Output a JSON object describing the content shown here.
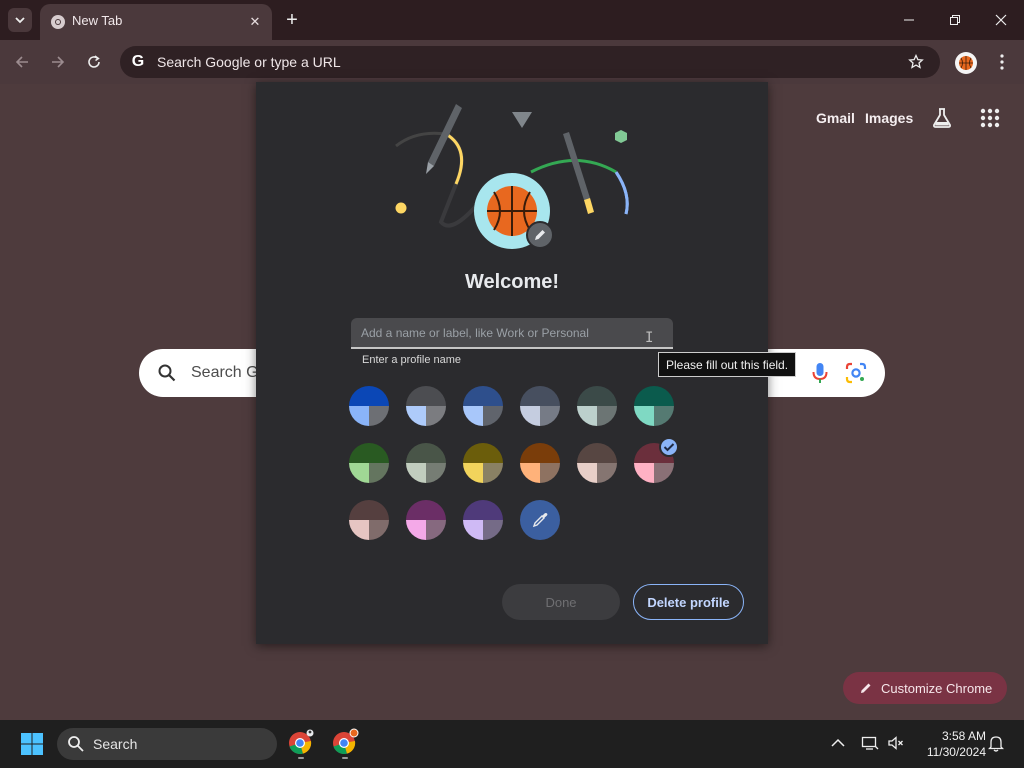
{
  "browser": {
    "tab_title": "New Tab",
    "omnibox_placeholder": "Search Google or type a URL"
  },
  "ntp": {
    "gmail_link": "Gmail",
    "images_link": "Images",
    "search_placeholder": "Search Go",
    "customize_label": "Customize Chrome"
  },
  "dialog": {
    "title": "Welcome!",
    "name_placeholder": "Add a name or label, like Work or Personal",
    "helper_text": "Enter a profile name",
    "done_label": "Done",
    "delete_label": "Delete profile",
    "tooltip": "Please fill out this field.",
    "color_swatches": [
      {
        "top": "#0b47b6",
        "left": "#8ab4f8",
        "right": "#6d6f74"
      },
      {
        "top": "#4c4d51",
        "left": "#aecbfa",
        "right": "#7b7c80"
      },
      {
        "top": "#2e4f8c",
        "left": "#a8c7fa",
        "right": "#60646c"
      },
      {
        "top": "#474f5f",
        "left": "#c5cde0",
        "right": "#767b86"
      },
      {
        "top": "#3b4a48",
        "left": "#bcd0cc",
        "right": "#6c7574"
      },
      {
        "top": "#0b5b4d",
        "left": "#7fd9c3",
        "right": "#557a72"
      },
      {
        "top": "#295a22",
        "left": "#a0d895",
        "right": "#64755f"
      },
      {
        "top": "#495548",
        "left": "#c1cdbe",
        "right": "#767d74"
      },
      {
        "top": "#6b5d0b",
        "left": "#f2d45c",
        "right": "#8a8164"
      },
      {
        "top": "#7a3d0a",
        "left": "#ffb27a",
        "right": "#8e7261"
      },
      {
        "top": "#574642",
        "left": "#e8cfc8",
        "right": "#857571"
      },
      {
        "top": "#6b2f3c",
        "left": "#ffb1c4",
        "right": "#8a7076"
      },
      {
        "top": "#553f3f",
        "left": "#e6c5c2",
        "right": "#806c6b"
      },
      {
        "top": "#6b2e66",
        "left": "#f4a9e8",
        "right": "#86697f"
      },
      {
        "top": "#4f3a7a",
        "left": "#cfbaf5",
        "right": "#756b87"
      }
    ],
    "selected_swatch": 11
  },
  "taskbar": {
    "search_label": "Search",
    "time": "3:58 AM",
    "date": "11/30/2024"
  }
}
